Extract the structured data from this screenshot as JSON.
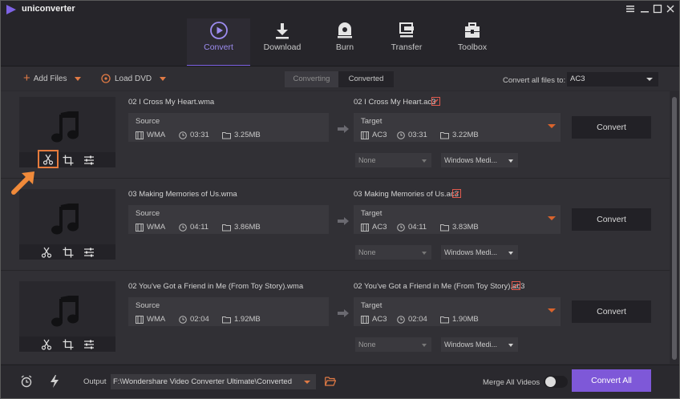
{
  "app": {
    "name": "uniconverter"
  },
  "colors": {
    "accent": "#7e63e6",
    "orange": "#e07a45",
    "convert_all_bg": "#7e58d8"
  },
  "nav": [
    {
      "label": "Convert",
      "icon": "play-circle-icon",
      "active": true
    },
    {
      "label": "Download",
      "icon": "download-icon",
      "active": false
    },
    {
      "label": "Burn",
      "icon": "disc-icon",
      "active": false
    },
    {
      "label": "Transfer",
      "icon": "transfer-icon",
      "active": false
    },
    {
      "label": "Toolbox",
      "icon": "toolbox-icon",
      "active": false
    }
  ],
  "toolbar": {
    "add_files": "Add Files",
    "load_dvd": "Load DVD",
    "tab_converting": "Converting",
    "tab_converted": "Converted",
    "convert_all_to_label": "Convert all files to:",
    "convert_all_to_value": "AC3"
  },
  "files": [
    {
      "source_name": "02 I Cross My Heart.wma",
      "target_name": "02 I Cross My Heart.ac3",
      "source": {
        "title": "Source",
        "format": "WMA",
        "duration": "03:31",
        "size": "3.25MB"
      },
      "target": {
        "title": "Target",
        "format": "AC3",
        "duration": "03:31",
        "size": "3.22MB"
      },
      "subtitle": "None",
      "audio": "Windows Medi...",
      "convert_label": "Convert"
    },
    {
      "source_name": "03 Making Memories of Us.wma",
      "target_name": "03 Making Memories of Us.ac3",
      "source": {
        "title": "Source",
        "format": "WMA",
        "duration": "04:11",
        "size": "3.86MB"
      },
      "target": {
        "title": "Target",
        "format": "AC3",
        "duration": "04:11",
        "size": "3.83MB"
      },
      "subtitle": "None",
      "audio": "Windows Medi...",
      "convert_label": "Convert"
    },
    {
      "source_name": "02 You've Got a Friend in Me (From Toy Story).wma",
      "target_name": "02 You've Got a Friend in Me (From Toy Story).ac3",
      "source": {
        "title": "Source",
        "format": "WMA",
        "duration": "02:04",
        "size": "1.92MB"
      },
      "target": {
        "title": "Target",
        "format": "AC3",
        "duration": "02:04",
        "size": "1.90MB"
      },
      "subtitle": "None",
      "audio": "Windows Medi...",
      "convert_label": "Convert"
    }
  ],
  "bottom": {
    "output_label": "Output",
    "output_path": "F:\\Wondershare Video Converter Ultimate\\Converted",
    "merge_label": "Merge All Videos",
    "merge_on": false,
    "convert_all": "Convert All"
  }
}
